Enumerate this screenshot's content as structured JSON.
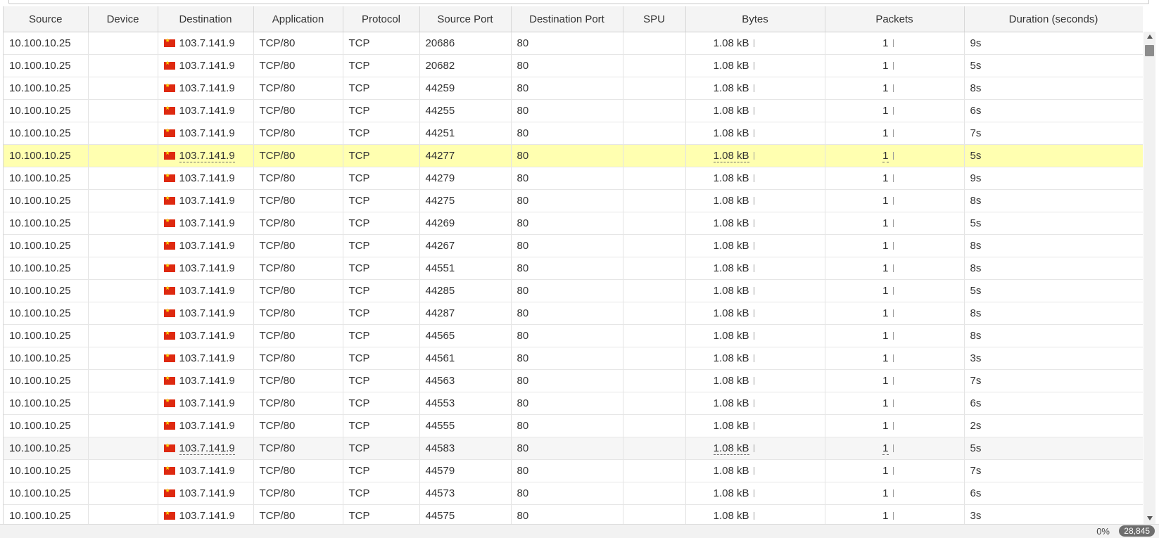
{
  "table": {
    "headers": [
      "Source",
      "Device",
      "Destination",
      "Application",
      "Protocol",
      "Source Port",
      "Destination Port",
      "SPU",
      "Bytes",
      "Packets",
      "Duration (seconds)"
    ],
    "rows": [
      {
        "source": "10.100.10.25",
        "device": "",
        "destination": "103.7.141.9",
        "application": "TCP/80",
        "protocol": "TCP",
        "source_port": "20686",
        "destination_port": "80",
        "spu": "",
        "bytes": "1.08 kB",
        "packets": "1",
        "duration": "9s"
      },
      {
        "source": "10.100.10.25",
        "device": "",
        "destination": "103.7.141.9",
        "application": "TCP/80",
        "protocol": "TCP",
        "source_port": "20682",
        "destination_port": "80",
        "spu": "",
        "bytes": "1.08 kB",
        "packets": "1",
        "duration": "5s"
      },
      {
        "source": "10.100.10.25",
        "device": "",
        "destination": "103.7.141.9",
        "application": "TCP/80",
        "protocol": "TCP",
        "source_port": "44259",
        "destination_port": "80",
        "spu": "",
        "bytes": "1.08 kB",
        "packets": "1",
        "duration": "8s"
      },
      {
        "source": "10.100.10.25",
        "device": "",
        "destination": "103.7.141.9",
        "application": "TCP/80",
        "protocol": "TCP",
        "source_port": "44255",
        "destination_port": "80",
        "spu": "",
        "bytes": "1.08 kB",
        "packets": "1",
        "duration": "6s"
      },
      {
        "source": "10.100.10.25",
        "device": "",
        "destination": "103.7.141.9",
        "application": "TCP/80",
        "protocol": "TCP",
        "source_port": "44251",
        "destination_port": "80",
        "spu": "",
        "bytes": "1.08 kB",
        "packets": "1",
        "duration": "7s"
      },
      {
        "source": "10.100.10.25",
        "device": "",
        "destination": "103.7.141.9",
        "application": "TCP/80",
        "protocol": "TCP",
        "source_port": "44277",
        "destination_port": "80",
        "spu": "",
        "bytes": "1.08 kB",
        "packets": "1",
        "duration": "5s"
      },
      {
        "source": "10.100.10.25",
        "device": "",
        "destination": "103.7.141.9",
        "application": "TCP/80",
        "protocol": "TCP",
        "source_port": "44279",
        "destination_port": "80",
        "spu": "",
        "bytes": "1.08 kB",
        "packets": "1",
        "duration": "9s"
      },
      {
        "source": "10.100.10.25",
        "device": "",
        "destination": "103.7.141.9",
        "application": "TCP/80",
        "protocol": "TCP",
        "source_port": "44275",
        "destination_port": "80",
        "spu": "",
        "bytes": "1.08 kB",
        "packets": "1",
        "duration": "8s"
      },
      {
        "source": "10.100.10.25",
        "device": "",
        "destination": "103.7.141.9",
        "application": "TCP/80",
        "protocol": "TCP",
        "source_port": "44269",
        "destination_port": "80",
        "spu": "",
        "bytes": "1.08 kB",
        "packets": "1",
        "duration": "5s"
      },
      {
        "source": "10.100.10.25",
        "device": "",
        "destination": "103.7.141.9",
        "application": "TCP/80",
        "protocol": "TCP",
        "source_port": "44267",
        "destination_port": "80",
        "spu": "",
        "bytes": "1.08 kB",
        "packets": "1",
        "duration": "8s"
      },
      {
        "source": "10.100.10.25",
        "device": "",
        "destination": "103.7.141.9",
        "application": "TCP/80",
        "protocol": "TCP",
        "source_port": "44551",
        "destination_port": "80",
        "spu": "",
        "bytes": "1.08 kB",
        "packets": "1",
        "duration": "8s"
      },
      {
        "source": "10.100.10.25",
        "device": "",
        "destination": "103.7.141.9",
        "application": "TCP/80",
        "protocol": "TCP",
        "source_port": "44285",
        "destination_port": "80",
        "spu": "",
        "bytes": "1.08 kB",
        "packets": "1",
        "duration": "5s"
      },
      {
        "source": "10.100.10.25",
        "device": "",
        "destination": "103.7.141.9",
        "application": "TCP/80",
        "protocol": "TCP",
        "source_port": "44287",
        "destination_port": "80",
        "spu": "",
        "bytes": "1.08 kB",
        "packets": "1",
        "duration": "8s"
      },
      {
        "source": "10.100.10.25",
        "device": "",
        "destination": "103.7.141.9",
        "application": "TCP/80",
        "protocol": "TCP",
        "source_port": "44565",
        "destination_port": "80",
        "spu": "",
        "bytes": "1.08 kB",
        "packets": "1",
        "duration": "8s"
      },
      {
        "source": "10.100.10.25",
        "device": "",
        "destination": "103.7.141.9",
        "application": "TCP/80",
        "protocol": "TCP",
        "source_port": "44561",
        "destination_port": "80",
        "spu": "",
        "bytes": "1.08 kB",
        "packets": "1",
        "duration": "3s"
      },
      {
        "source": "10.100.10.25",
        "device": "",
        "destination": "103.7.141.9",
        "application": "TCP/80",
        "protocol": "TCP",
        "source_port": "44563",
        "destination_port": "80",
        "spu": "",
        "bytes": "1.08 kB",
        "packets": "1",
        "duration": "7s"
      },
      {
        "source": "10.100.10.25",
        "device": "",
        "destination": "103.7.141.9",
        "application": "TCP/80",
        "protocol": "TCP",
        "source_port": "44553",
        "destination_port": "80",
        "spu": "",
        "bytes": "1.08 kB",
        "packets": "1",
        "duration": "6s"
      },
      {
        "source": "10.100.10.25",
        "device": "",
        "destination": "103.7.141.9",
        "application": "TCP/80",
        "protocol": "TCP",
        "source_port": "44555",
        "destination_port": "80",
        "spu": "",
        "bytes": "1.08 kB",
        "packets": "1",
        "duration": "2s"
      },
      {
        "source": "10.100.10.25",
        "device": "",
        "destination": "103.7.141.9",
        "application": "TCP/80",
        "protocol": "TCP",
        "source_port": "44583",
        "destination_port": "80",
        "spu": "",
        "bytes": "1.08 kB",
        "packets": "1",
        "duration": "5s"
      },
      {
        "source": "10.100.10.25",
        "device": "",
        "destination": "103.7.141.9",
        "application": "TCP/80",
        "protocol": "TCP",
        "source_port": "44579",
        "destination_port": "80",
        "spu": "",
        "bytes": "1.08 kB",
        "packets": "1",
        "duration": "7s"
      },
      {
        "source": "10.100.10.25",
        "device": "",
        "destination": "103.7.141.9",
        "application": "TCP/80",
        "protocol": "TCP",
        "source_port": "44573",
        "destination_port": "80",
        "spu": "",
        "bytes": "1.08 kB",
        "packets": "1",
        "duration": "6s"
      },
      {
        "source": "10.100.10.25",
        "device": "",
        "destination": "103.7.141.9",
        "application": "TCP/80",
        "protocol": "TCP",
        "source_port": "44575",
        "destination_port": "80",
        "spu": "",
        "bytes": "1.08 kB",
        "packets": "1",
        "duration": "3s"
      }
    ],
    "highlighted_row": 5,
    "hovered_row": 18,
    "destination_flag_icon": "china-flag-icon"
  },
  "footer": {
    "percent": "0%",
    "total_count": "28,845"
  },
  "colors": {
    "highlight": "#ffffb0",
    "header_bg": "#f4f4f4",
    "flag_red": "#de2910"
  }
}
